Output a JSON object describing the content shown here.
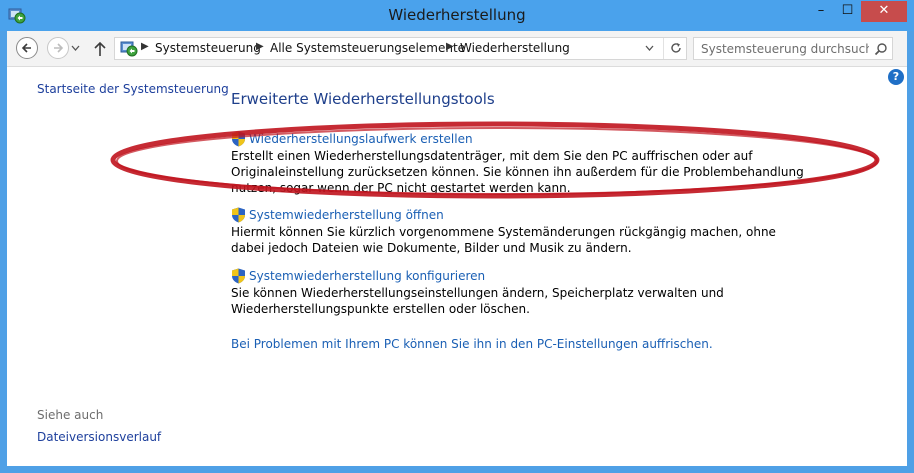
{
  "window": {
    "title": "Wiederherstellung",
    "controls": {
      "minimize": "–",
      "maximize": "☐",
      "close": "✕"
    }
  },
  "address_bar": {
    "breadcrumbs": [
      "Systemsteuerung",
      "Alle Systemsteuerungselemente",
      "Wiederherstellung"
    ],
    "search_placeholder": "Systemsteuerung durchsuchen"
  },
  "sidebar": {
    "home_link": "Startseite der Systemsteuerung",
    "see_also_label": "Siehe auch",
    "see_also_links": [
      "Dateiversionsverlauf"
    ]
  },
  "main": {
    "heading": "Erweiterte Wiederherstellungstools",
    "tasks": [
      {
        "link": "Wiederherstellungslaufwerk erstellen",
        "description": "Erstellt einen Wiederherstellungsdatenträger, mit dem Sie den PC auffrischen oder auf Originaleinstellung zurücksetzen können. Sie können ihn außerdem für die Problembehandlung nutzen, sogar wenn der PC nicht gestartet werden kann."
      },
      {
        "link": "Systemwiederherstellung öffnen",
        "description": "Hiermit können Sie kürzlich vorgenommene Systemänderungen rückgängig machen, ohne dabei jedoch Dateien wie Dokumente, Bilder und Musik zu ändern."
      },
      {
        "link": "Systemwiederherstellung konfigurieren",
        "description": "Sie können Wiederherstellungseinstellungen ändern, Speicherplatz verwalten und Wiederherstellungspunkte erstellen oder löschen."
      }
    ],
    "refresh_link": "Bei Problemen mit Ihrem PC können Sie ihn in den PC-Einstellungen auffrischen."
  },
  "help_icon": "?",
  "colors": {
    "titlebar": "#4aa2ec",
    "close_button": "#c74c4c",
    "link": "#1a5fb4",
    "heading": "#1e3f8b",
    "annotation_ellipse": "#c0141e"
  }
}
